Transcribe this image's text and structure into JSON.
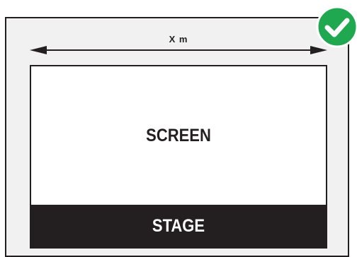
{
  "diagram": {
    "dimension_label": "X m",
    "screen_label": "SCREEN",
    "stage_label": "STAGE",
    "approved_icon": "check-circle-icon",
    "colors": {
      "outline": "#231f20",
      "room_fill": "#f1f1f1",
      "screen_fill": "#ffffff",
      "stage_fill": "#231f20",
      "badge": "#1fa84f"
    }
  }
}
